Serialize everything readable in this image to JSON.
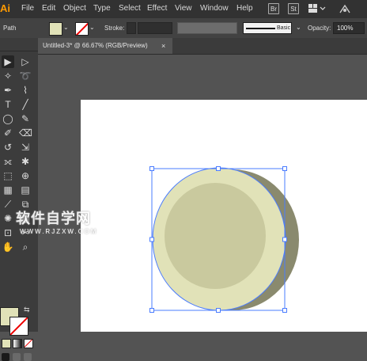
{
  "app": {
    "logo": "Ai",
    "menu": [
      "File",
      "Edit",
      "Object",
      "Type",
      "Select",
      "Effect",
      "View",
      "Window",
      "Help"
    ],
    "bridge_label": "Br",
    "stock_label": "St"
  },
  "control": {
    "selection_type": "Path",
    "stroke_label": "Stroke:",
    "brush_label": "Basic",
    "opacity_label": "Opacity:",
    "opacity_value": "100%"
  },
  "document": {
    "tab_title": "Untitled-3* @ 66.67% (RGB/Preview)",
    "close_glyph": "×"
  },
  "colors": {
    "fill": "#e1e2b8",
    "inner": "#c9c99e",
    "shadow": "#8a8a6e",
    "selection": "#4a7cff"
  },
  "watermark": {
    "main": "软件自学网",
    "url": "WWW.RJZXW.COM"
  },
  "tools": [
    {
      "name": "selection-tool",
      "glyph": "▶"
    },
    {
      "name": "direct-selection-tool",
      "glyph": "▷"
    },
    {
      "name": "magic-wand-tool",
      "glyph": "✧"
    },
    {
      "name": "lasso-tool",
      "glyph": "➰"
    },
    {
      "name": "pen-tool",
      "glyph": "✒"
    },
    {
      "name": "curvature-tool",
      "glyph": "⌇"
    },
    {
      "name": "type-tool",
      "glyph": "T"
    },
    {
      "name": "line-tool",
      "glyph": "╱"
    },
    {
      "name": "ellipse-tool",
      "glyph": "◯"
    },
    {
      "name": "paintbrush-tool",
      "glyph": "✎"
    },
    {
      "name": "shaper-tool",
      "glyph": "✐"
    },
    {
      "name": "eraser-tool",
      "glyph": "⌫"
    },
    {
      "name": "rotate-tool",
      "glyph": "↺"
    },
    {
      "name": "scale-tool",
      "glyph": "⇲"
    },
    {
      "name": "width-tool",
      "glyph": "⟗"
    },
    {
      "name": "puppet-warp-tool",
      "glyph": "✱"
    },
    {
      "name": "free-transform-tool",
      "glyph": "⬚"
    },
    {
      "name": "shape-builder-tool",
      "glyph": "⊕"
    },
    {
      "name": "mesh-tool",
      "glyph": "▦"
    },
    {
      "name": "gradient-tool",
      "glyph": "▤"
    },
    {
      "name": "eyedropper-tool",
      "glyph": "⟋"
    },
    {
      "name": "blend-tool",
      "glyph": "⧉"
    },
    {
      "name": "symbol-sprayer-tool",
      "glyph": "✺"
    },
    {
      "name": "graph-tool",
      "glyph": "▥"
    },
    {
      "name": "artboard-tool",
      "glyph": "⊡"
    },
    {
      "name": "slice-tool",
      "glyph": "✂"
    },
    {
      "name": "hand-tool",
      "glyph": "✋"
    },
    {
      "name": "zoom-tool",
      "glyph": "⌕"
    }
  ]
}
